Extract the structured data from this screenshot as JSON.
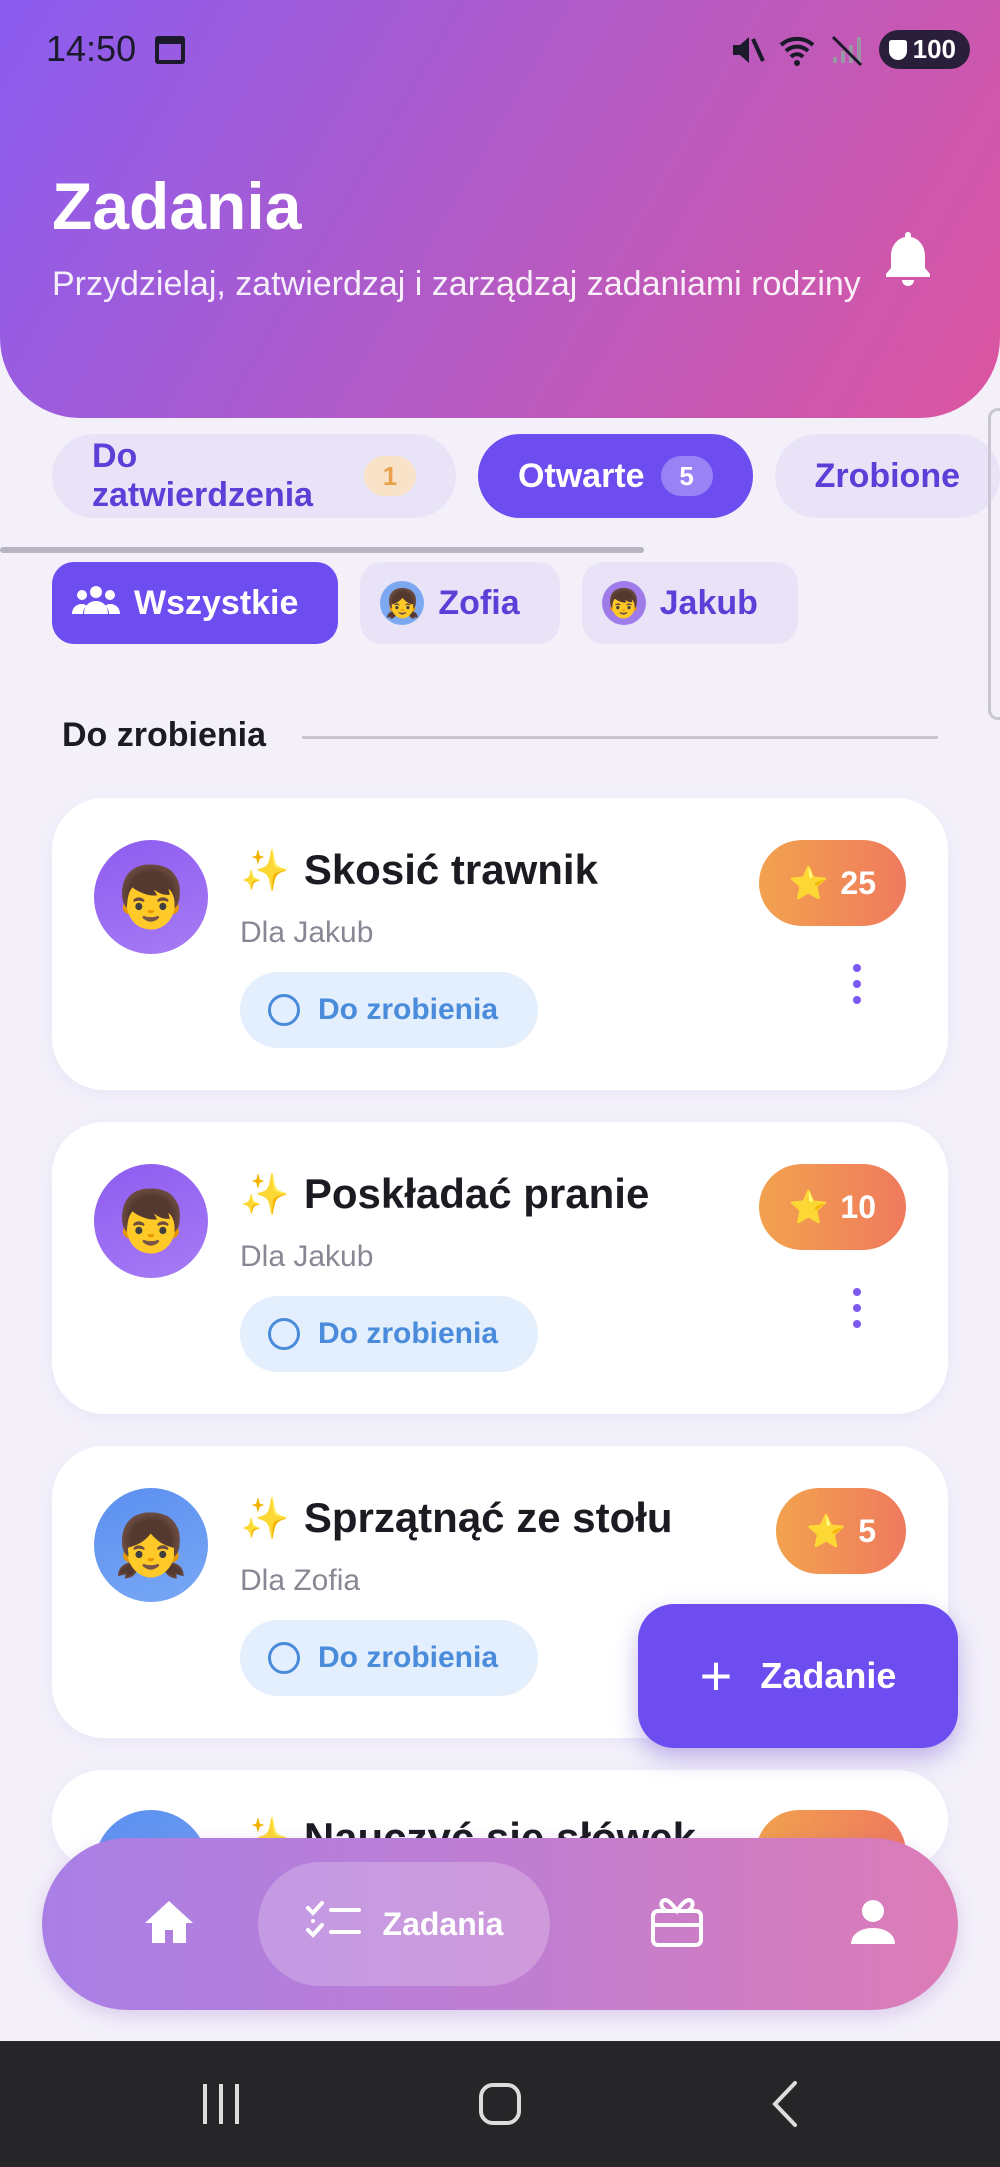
{
  "status_bar": {
    "time": "14:50",
    "battery": "100"
  },
  "header": {
    "title": "Zadania",
    "subtitle": "Przydzielaj, zatwierdzaj i zarządzaj zadaniami rodziny"
  },
  "status_tabs": [
    {
      "label": "Do zatwierdzenia",
      "count": "1",
      "active": false
    },
    {
      "label": "Otwarte",
      "count": "5",
      "active": true
    },
    {
      "label": "Zrobione",
      "count": "",
      "active": false
    }
  ],
  "member_chips": [
    {
      "label": "Wszystkie",
      "active": true
    },
    {
      "label": "Zofia",
      "active": false
    },
    {
      "label": "Jakub",
      "active": false
    }
  ],
  "section": {
    "title": "Do zrobienia"
  },
  "tasks": [
    {
      "title": "Skosić trawnik",
      "assignee": "Dla Jakub",
      "status": "Do zrobienia",
      "points": "25"
    },
    {
      "title": "Poskładać pranie",
      "assignee": "Dla Jakub",
      "status": "Do zrobienia",
      "points": "10"
    },
    {
      "title": "Sprzątnąć ze stołu",
      "assignee": "Dla Zofia",
      "status": "Do zrobienia",
      "points": "5"
    },
    {
      "title": "Nauczyć się słówek",
      "assignee": "",
      "status": "",
      "points": ""
    }
  ],
  "fab": {
    "label": "Zadanie"
  },
  "bottom_nav": {
    "items": [
      {
        "label": "",
        "icon": "home-icon"
      },
      {
        "label": "Zadania",
        "icon": "tasks-icon"
      },
      {
        "label": "",
        "icon": "gift-icon"
      },
      {
        "label": "",
        "icon": "profile-icon"
      }
    ]
  },
  "colors": {
    "primary": "#6D4CF0",
    "header_gradient_start": "#8B5CF0",
    "header_gradient_end": "#DC55A0",
    "points_orange": "#F2A24E",
    "status_blue": "#4A8BDC"
  }
}
